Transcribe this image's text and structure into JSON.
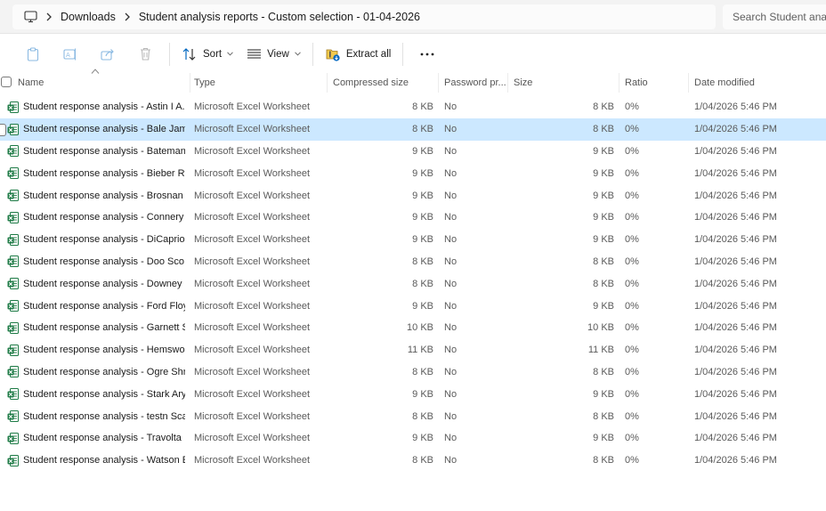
{
  "breadcrumb": {
    "items": [
      "Downloads",
      "Student analysis reports - Custom selection - 01-04-2026"
    ]
  },
  "search": {
    "placeholder": "Search Student anal"
  },
  "toolbar": {
    "sort_label": "Sort",
    "view_label": "View",
    "extract_label": "Extract all"
  },
  "columns": {
    "name": "Name",
    "type": "Type",
    "compressed": "Compressed size",
    "password": "Password pr...",
    "size": "Size",
    "ratio": "Ratio",
    "date": "Date modified"
  },
  "selected_row_index": 1,
  "files": [
    {
      "name": "Student response analysis - Astin I  A...",
      "type": "Microsoft Excel Worksheet",
      "compressed": "8 KB",
      "password": "No",
      "size": "8 KB",
      "ratio": "0%",
      "date": "1/04/2026 5:46 PM"
    },
    {
      "name": "Student response analysis - Bale  Jam...",
      "type": "Microsoft Excel Worksheet",
      "compressed": "8 KB",
      "password": "No",
      "size": "8 KB",
      "ratio": "0%",
      "date": "1/04/2026 5:46 PM"
    },
    {
      "name": "Student response analysis - Bateman  ...",
      "type": "Microsoft Excel Worksheet",
      "compressed": "9 KB",
      "password": "No",
      "size": "9 KB",
      "ratio": "0%",
      "date": "1/04/2026 5:46 PM"
    },
    {
      "name": "Student response analysis - Bieber  Ry...",
      "type": "Microsoft Excel Worksheet",
      "compressed": "9 KB",
      "password": "No",
      "size": "9 KB",
      "ratio": "0%",
      "date": "1/04/2026 5:46 PM"
    },
    {
      "name": "Student response analysis - Brosnan I ...",
      "type": "Microsoft Excel Worksheet",
      "compressed": "9 KB",
      "password": "No",
      "size": "9 KB",
      "ratio": "0%",
      "date": "1/04/2026 5:46 PM"
    },
    {
      "name": "Student response analysis - Connery  ...",
      "type": "Microsoft Excel Worksheet",
      "compressed": "9 KB",
      "password": "No",
      "size": "9 KB",
      "ratio": "0%",
      "date": "1/04/2026 5:46 PM"
    },
    {
      "name": "Student response analysis - DiCaprio  ...",
      "type": "Microsoft Excel Worksheet",
      "compressed": "9 KB",
      "password": "No",
      "size": "9 KB",
      "ratio": "0%",
      "date": "1/04/2026 5:46 PM"
    },
    {
      "name": "Student response analysis - Doo  Sco...",
      "type": "Microsoft Excel Worksheet",
      "compressed": "8 KB",
      "password": "No",
      "size": "8 KB",
      "ratio": "0%",
      "date": "1/04/2026 5:46 PM"
    },
    {
      "name": "Student response analysis - Downey  ...",
      "type": "Microsoft Excel Worksheet",
      "compressed": "8 KB",
      "password": "No",
      "size": "8 KB",
      "ratio": "0%",
      "date": "1/04/2026 5:46 PM"
    },
    {
      "name": "Student response analysis - Ford  Floy...",
      "type": "Microsoft Excel Worksheet",
      "compressed": "9 KB",
      "password": "No",
      "size": "9 KB",
      "ratio": "0%",
      "date": "1/04/2026 5:46 PM"
    },
    {
      "name": "Student response analysis - Garnett  S...",
      "type": "Microsoft Excel Worksheet",
      "compressed": "10 KB",
      "password": "No",
      "size": "10 KB",
      "ratio": "0%",
      "date": "1/04/2026 5:46 PM"
    },
    {
      "name": "Student response analysis - Hemswor...",
      "type": "Microsoft Excel Worksheet",
      "compressed": "11 KB",
      "password": "No",
      "size": "11 KB",
      "ratio": "0%",
      "date": "1/04/2026 5:46 PM"
    },
    {
      "name": "Student response analysis - Ogre  Shr...",
      "type": "Microsoft Excel Worksheet",
      "compressed": "8 KB",
      "password": "No",
      "size": "8 KB",
      "ratio": "0%",
      "date": "1/04/2026 5:46 PM"
    },
    {
      "name": "Student response analysis - Stark  Ary...",
      "type": "Microsoft Excel Worksheet",
      "compressed": "9 KB",
      "password": "No",
      "size": "9 KB",
      "ratio": "0%",
      "date": "1/04/2026 5:46 PM"
    },
    {
      "name": "Student response analysis - testn  Sca...",
      "type": "Microsoft Excel Worksheet",
      "compressed": "8 KB",
      "password": "No",
      "size": "8 KB",
      "ratio": "0%",
      "date": "1/04/2026 5:46 PM"
    },
    {
      "name": "Student response analysis - Travolta  ...",
      "type": "Microsoft Excel Worksheet",
      "compressed": "9 KB",
      "password": "No",
      "size": "9 KB",
      "ratio": "0%",
      "date": "1/04/2026 5:46 PM"
    },
    {
      "name": "Student response analysis - Watson  E...",
      "type": "Microsoft Excel Worksheet",
      "compressed": "8 KB",
      "password": "No",
      "size": "8 KB",
      "ratio": "0%",
      "date": "1/04/2026 5:46 PM"
    }
  ],
  "colors": {
    "selection": "#cce8ff",
    "excel_green": "#1d7a45",
    "accent_blue": "#0067c0"
  }
}
